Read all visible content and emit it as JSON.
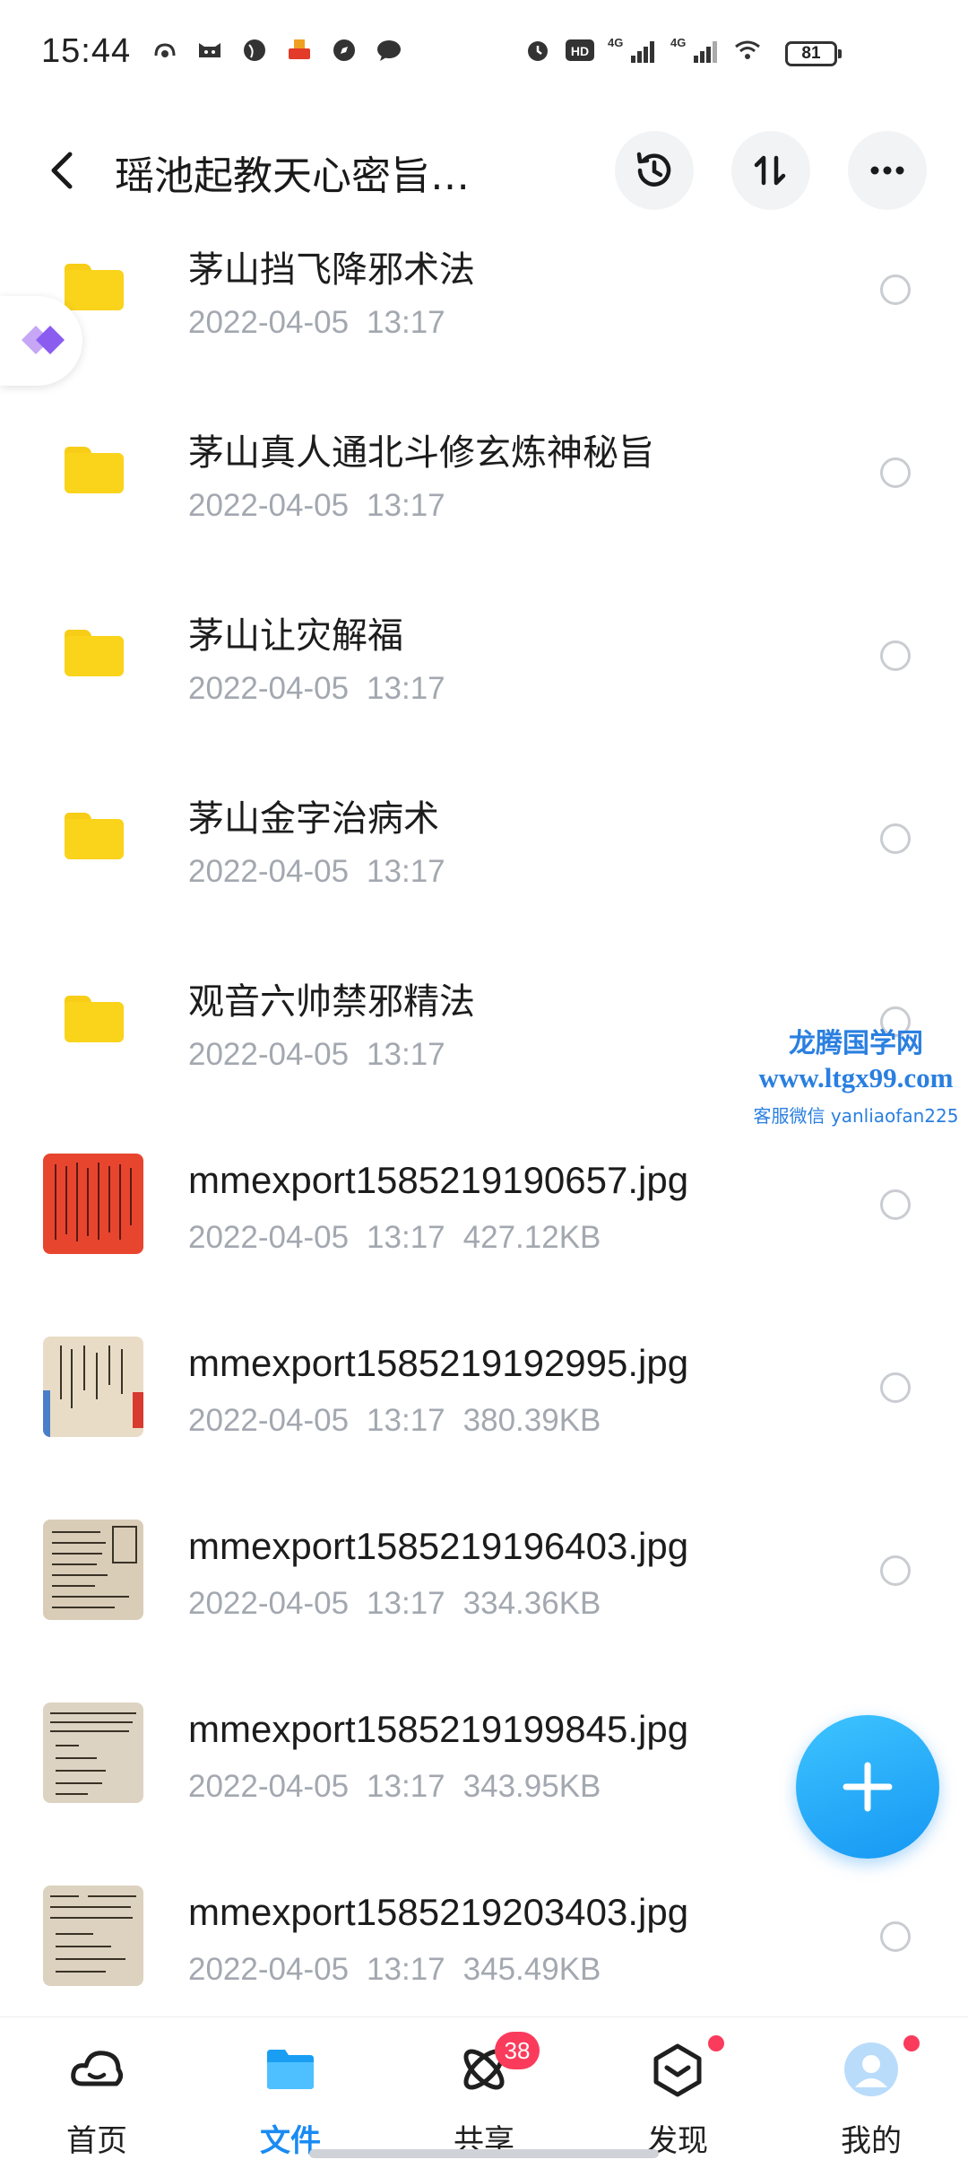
{
  "status_bar": {
    "time": "15:44",
    "battery": "81",
    "network_labels": [
      "HD",
      "4G",
      "4G"
    ]
  },
  "header": {
    "title": "瑶池起教天心密旨…",
    "icons": [
      "back-icon",
      "history-icon",
      "sort-icon",
      "more-icon"
    ]
  },
  "files": [
    {
      "name": "茅山挡飞降邪术法",
      "date": "2022-04-05",
      "time": "13:17",
      "type": "folder"
    },
    {
      "name": "茅山真人通北斗修玄炼神秘旨",
      "date": "2022-04-05",
      "time": "13:17",
      "type": "folder"
    },
    {
      "name": "茅山让灾解福",
      "date": "2022-04-05",
      "time": "13:17",
      "type": "folder"
    },
    {
      "name": "茅山金字治病术",
      "date": "2022-04-05",
      "time": "13:17",
      "type": "folder"
    },
    {
      "name": "观音六帅禁邪精法",
      "date": "2022-04-05",
      "time": "13:17",
      "type": "folder"
    },
    {
      "name": "mmexport1585219190657.jpg",
      "date": "2022-04-05",
      "time": "13:17",
      "size": "427.12KB",
      "type": "image"
    },
    {
      "name": "mmexport1585219192995.jpg",
      "date": "2022-04-05",
      "time": "13:17",
      "size": "380.39KB",
      "type": "image"
    },
    {
      "name": "mmexport1585219196403.jpg",
      "date": "2022-04-05",
      "time": "13:17",
      "size": "334.36KB",
      "type": "image"
    },
    {
      "name": "mmexport1585219199845.jpg",
      "date": "2022-04-05",
      "time": "13:17",
      "size": "343.95KB",
      "type": "image"
    },
    {
      "name": "mmexport1585219203403.jpg",
      "date": "2022-04-05",
      "time": "13:17",
      "size": "345.49KB",
      "type": "image"
    }
  ],
  "watermark": {
    "line1": "龙腾国学网",
    "line2": "www.ltgx99.com",
    "line3": "客服微信 yanliaofan225"
  },
  "bottom_nav": [
    {
      "label": "首页",
      "icon": "cloud-home-icon",
      "active": false
    },
    {
      "label": "文件",
      "icon": "folder-icon",
      "active": true
    },
    {
      "label": "共享",
      "icon": "share-orbit-icon",
      "active": false,
      "badge": "38"
    },
    {
      "label": "发现",
      "icon": "discover-box-icon",
      "active": false,
      "dot": true
    },
    {
      "label": "我的",
      "icon": "avatar-icon",
      "active": false,
      "dot": true
    }
  ],
  "colors": {
    "accent": "#1a8bf2",
    "folder": "#fad31b",
    "badge": "#fa3b5c",
    "meta_text": "#a3a8b0"
  }
}
